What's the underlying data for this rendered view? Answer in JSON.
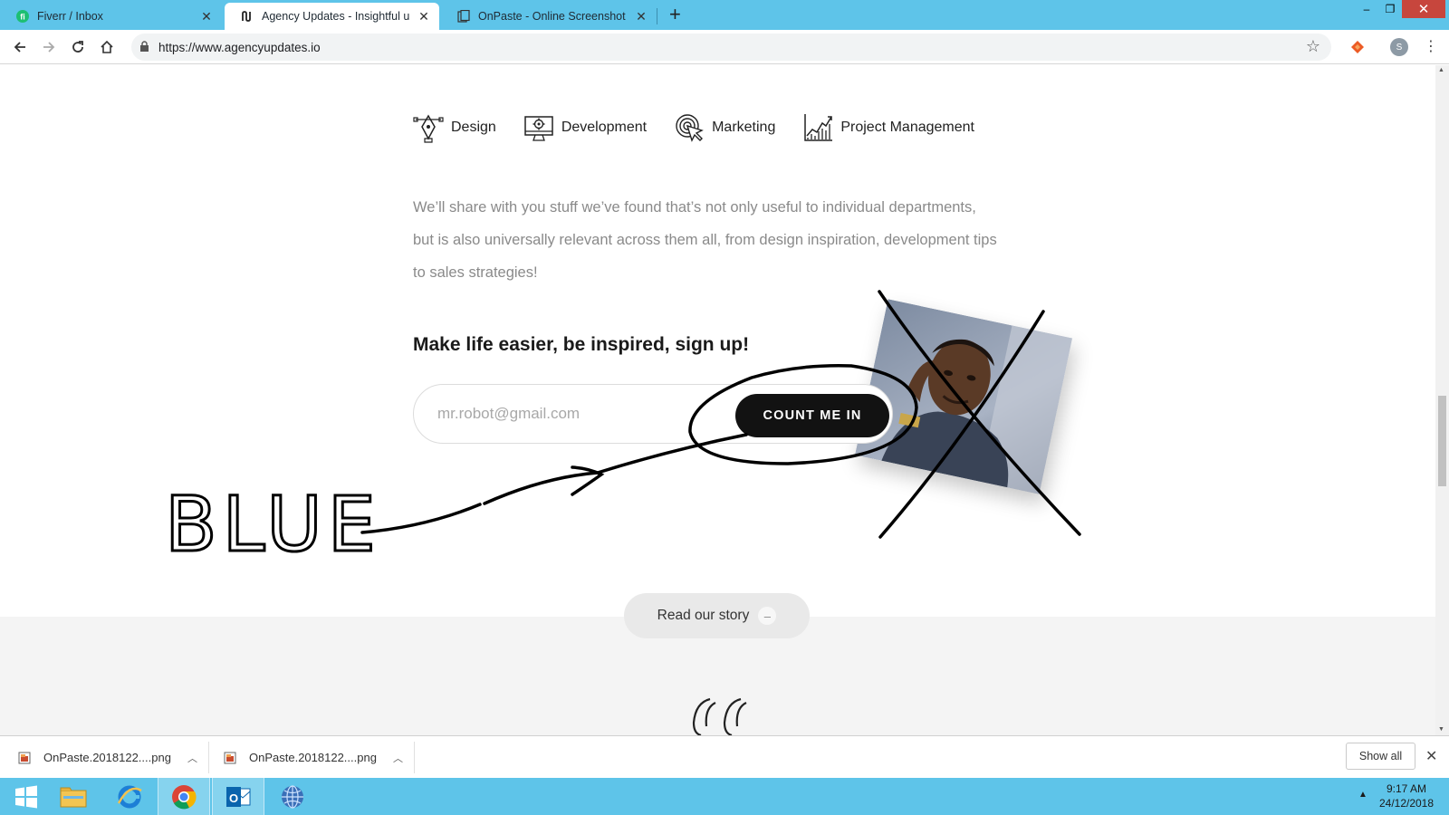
{
  "browser": {
    "tabs": [
      {
        "title": "Fiverr / Inbox",
        "active": false
      },
      {
        "title": "Agency Updates - Insightful upd",
        "active": true
      },
      {
        "title": "OnPaste - Online Screenshot and",
        "active": false
      }
    ],
    "new_tab": "+",
    "window_controls": {
      "minimize": "–",
      "restore": "❐",
      "close": "✕"
    },
    "url": "https://www.agencyupdates.io",
    "profile_initial": "S"
  },
  "page": {
    "categories": [
      {
        "label": "Design",
        "icon": "pen-tool-icon"
      },
      {
        "label": "Development",
        "icon": "monitor-gear-icon"
      },
      {
        "label": "Marketing",
        "icon": "target-cursor-icon"
      },
      {
        "label": "Project Management",
        "icon": "line-chart-icon"
      }
    ],
    "intro_lines": [
      "We’ll share with you stuff we’ve found that’s not only useful to individual departments,",
      "but is also universally relevant across them all, from design inspiration, development tips",
      "to sales strategies!"
    ],
    "signup_title": "Make life easier, be inspired, sign up!",
    "email_placeholder": "mr.robot@gmail.com",
    "cta_label": "COUNT ME IN",
    "story_label": "Read our story",
    "story_icon": "–",
    "annotation_text": "BLUE"
  },
  "downloads": [
    {
      "name": "OnPaste.2018122....png"
    },
    {
      "name": "OnPaste.2018122....png"
    }
  ],
  "show_all": "Show all",
  "taskbar": {
    "time": "9:17 AM",
    "date": "24/12/2018"
  },
  "colors": {
    "chrome_frame": "#5ec4e9",
    "cta_bg": "#121212",
    "text_grey": "#8a8a8a"
  }
}
